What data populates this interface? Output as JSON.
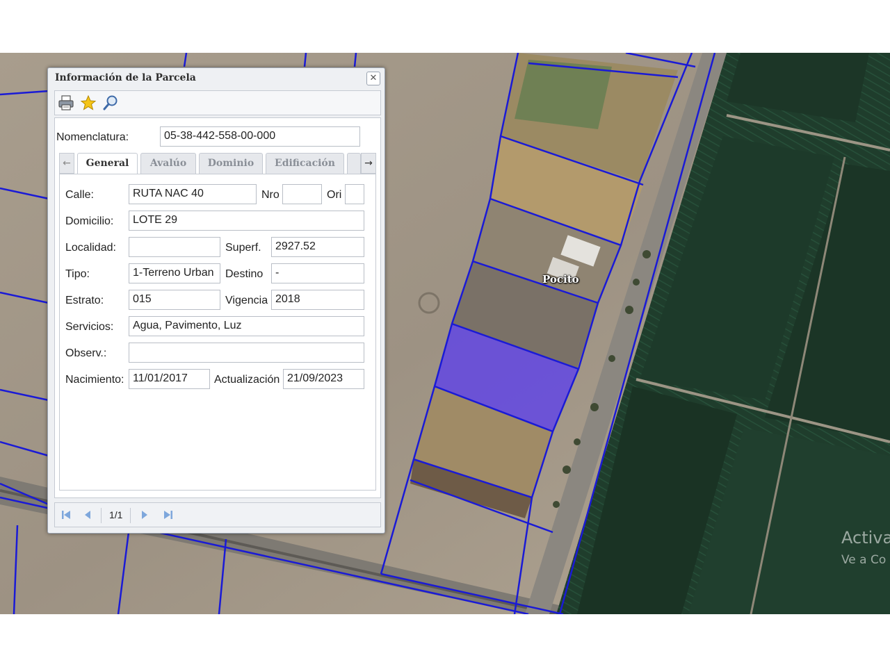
{
  "window": {
    "title": "Información de la Parcela",
    "close_icon": "close-icon"
  },
  "toolbar": {
    "icons": [
      "printer-icon",
      "star-icon",
      "magnifier-icon"
    ]
  },
  "nomenclatura": {
    "label": "Nomenclatura:",
    "value": "05-38-442-558-00-000"
  },
  "tabs": {
    "items": [
      {
        "label": "General",
        "active": true
      },
      {
        "label": "Avalúo",
        "active": false
      },
      {
        "label": "Dominio",
        "active": false
      },
      {
        "label": "Edificación",
        "active": false
      }
    ],
    "scroll_left_icon": "arrow-left-icon",
    "scroll_right_icon": "arrow-right-icon"
  },
  "general": {
    "calle": {
      "label": "Calle:",
      "value": "RUTA NAC 40"
    },
    "nro": {
      "label": "Nro",
      "value": ""
    },
    "ori": {
      "label": "Ori",
      "value": ""
    },
    "domicilio": {
      "label": "Domicilio:",
      "value": "LOTE 29"
    },
    "localidad": {
      "label": "Localidad:",
      "value": ""
    },
    "superf": {
      "label": "Superf.",
      "value": "2927.52"
    },
    "tipo": {
      "label": "Tipo:",
      "value": "1-Terreno Urban"
    },
    "destino": {
      "label": "Destino",
      "value": "-"
    },
    "estrato": {
      "label": "Estrato:",
      "value": "015"
    },
    "vigencia": {
      "label": "Vigencia",
      "value": "2018"
    },
    "servicios": {
      "label": "Servicios:",
      "value": "Agua, Pavimento, Luz"
    },
    "observ": {
      "label": "Observ.:",
      "value": ""
    },
    "nacimiento": {
      "label": "Nacimiento:",
      "value": "11/01/2017"
    },
    "actualizacion": {
      "label": "Actualización",
      "value": "21/09/2023"
    }
  },
  "pager": {
    "text": "1/1",
    "icons": [
      "first-page-icon",
      "prev-page-icon",
      "next-page-icon",
      "last-page-icon"
    ]
  },
  "map": {
    "place_label": "Pocito",
    "watermark_line1": "Activa",
    "watermark_line2": "Ve a Co",
    "colors": {
      "parcel_lines": "#1a1ad6",
      "selected_parcel": "#5a3cf0",
      "crop_field": "#1e3b2a",
      "desert": "#a69a89"
    }
  }
}
